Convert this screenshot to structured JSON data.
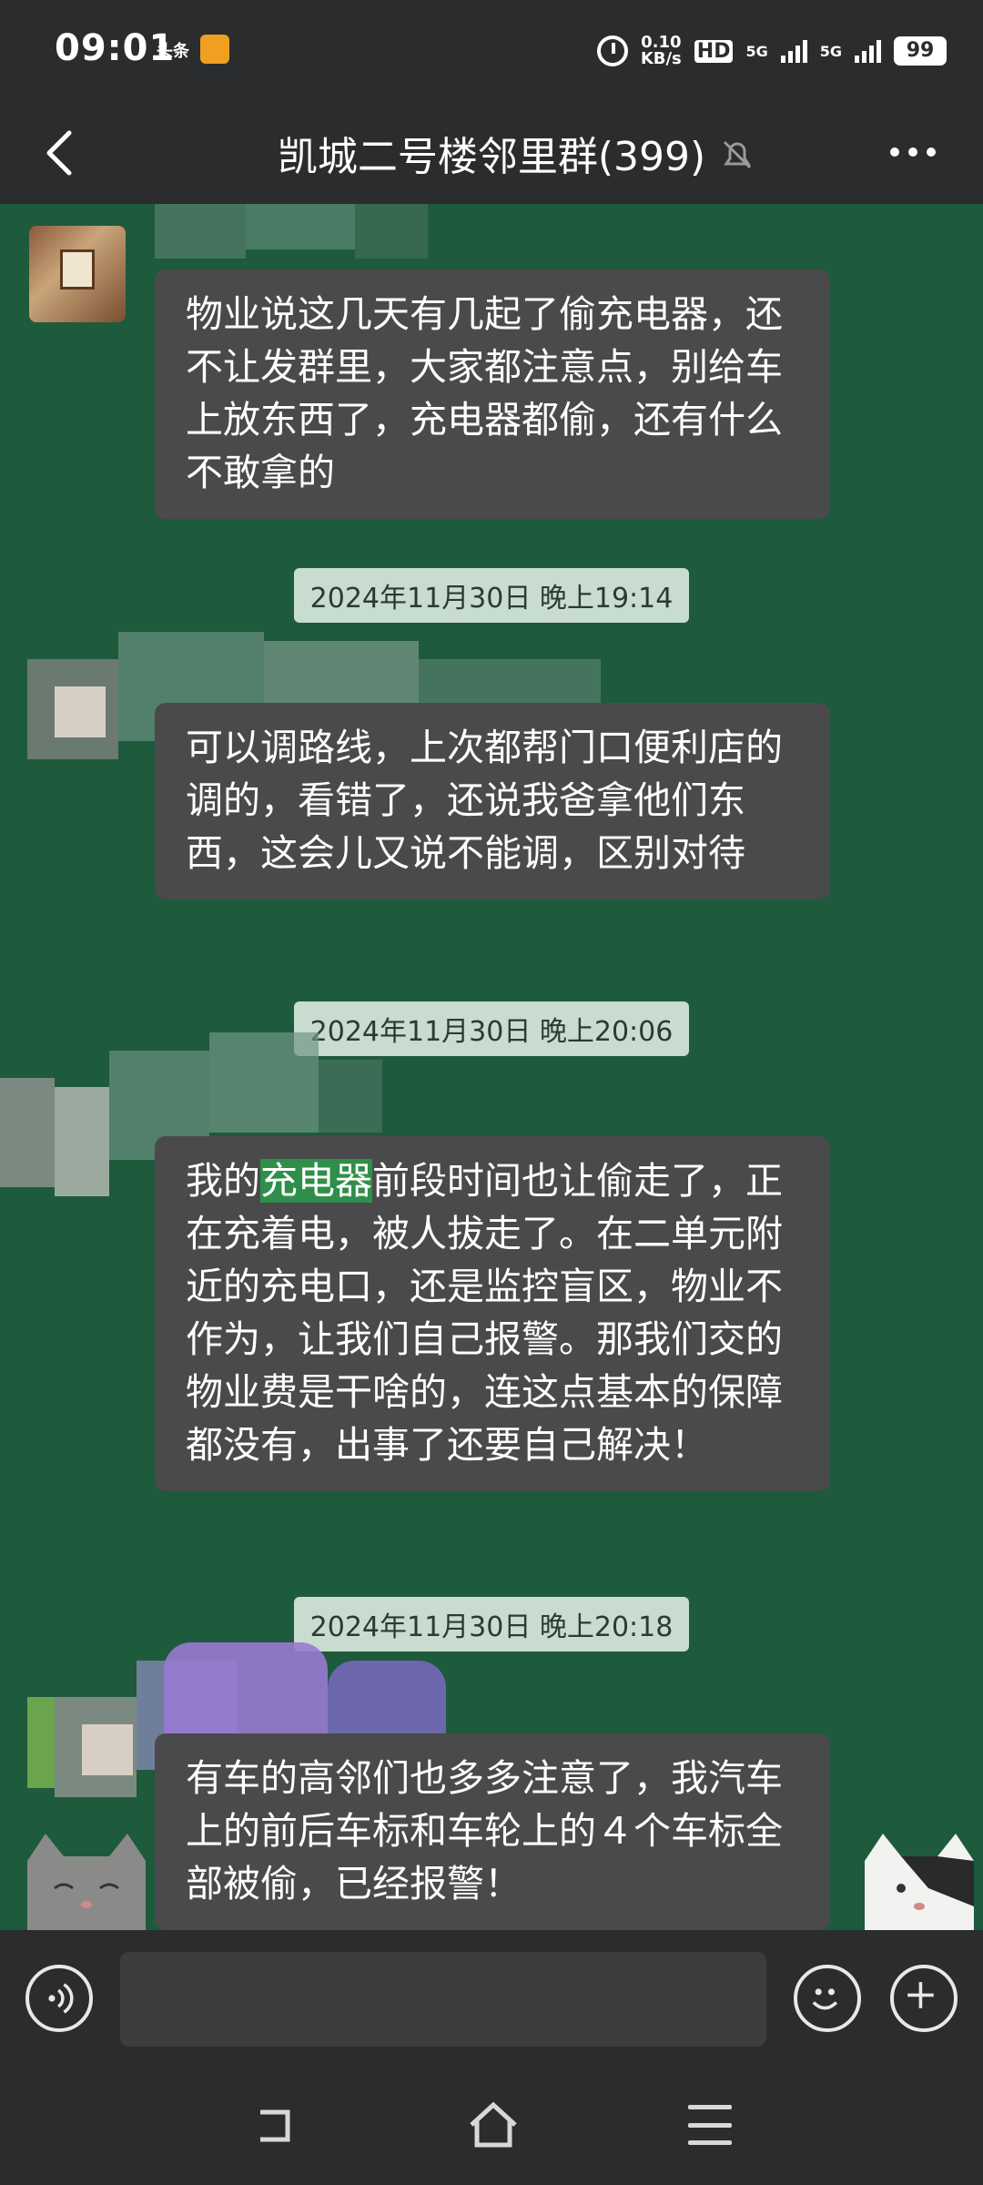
{
  "status_bar": {
    "time": "09:01",
    "app_badge": "头条",
    "net_speed_value": "0.10",
    "net_speed_unit": "KB/s",
    "hd_label": "HD",
    "network_1": "5G",
    "network_2": "5G",
    "battery": "99"
  },
  "header": {
    "title": "凯城二号楼邻里群(399)"
  },
  "messages": [
    {
      "text": "物业说这几天有几起了偷充电器，还不让发群里，大家都注意点，别给车上放东西了，充电器都偷，还有什么不敢拿的"
    },
    {
      "time": "2024年11月30日 晚上19:14",
      "text": "可以调路线，上次都帮门口便利店的调的，看错了，还说我爸拿他们东西，这会儿又说不能调，区别对待"
    },
    {
      "time": "2024年11月30日 晚上20:06",
      "text_before": "我的",
      "highlight": "充电器",
      "text_after": "前段时间也让偷走了，正在充着电，被人拔走了。在二单元附近的充电口，还是监控盲区，物业不作为，让我们自己报警。那我们交的物业费是干啥的，连这点基本的保障都没有，出事了还要自己解决！"
    },
    {
      "time": "2024年11月30日 晚上20:18",
      "text": "有车的高邻们也多多注意了，我汽车上的前后车标和车轮上的４个车标全部被偷，已经报警！"
    }
  ],
  "colors": {
    "chat_background": "#1e5a3c",
    "bubble": "#4a4a4c",
    "time_badge": "#c8dccf",
    "bars": "#2b2c2e",
    "highlight": "#2f8f4a"
  },
  "icons": [
    "back-icon",
    "mute-icon",
    "more-icon",
    "voice-icon",
    "emoji-icon",
    "plus-icon",
    "nav-back-icon",
    "nav-home-icon",
    "nav-menu-icon"
  ]
}
